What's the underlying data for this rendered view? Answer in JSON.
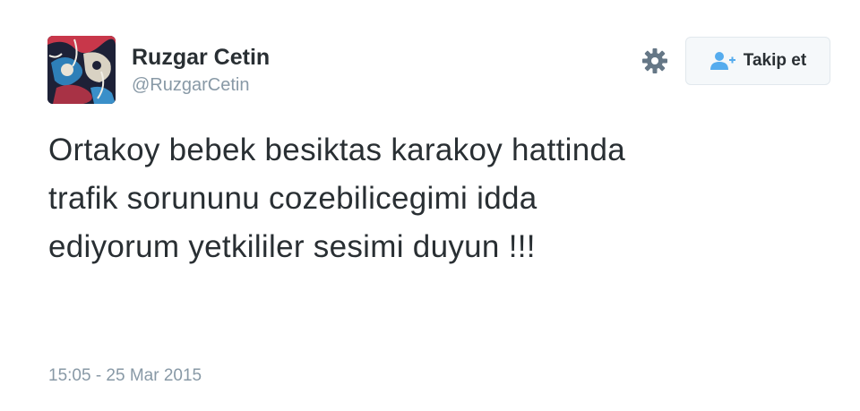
{
  "user": {
    "name": "Ruzgar Cetin",
    "handle": "@RuzgarCetin"
  },
  "actions": {
    "settings_icon": "gear-icon",
    "follow_icon": "add-user-icon",
    "follow_label": "Takip et"
  },
  "tweet": {
    "text_lines": [
      "Ortakoy bebek besiktas karakoy hattinda",
      "trafik sorununu cozebilicegimi idda",
      "ediyorum yetkililer sesimi duyun !!!"
    ],
    "timestamp": "15:05 - 25 Mar 2015"
  },
  "colors": {
    "text": "#292f33",
    "muted": "#8899a6",
    "accent": "#55acee",
    "button_bg": "#f5f8fa",
    "button_border": "#e1e8ed"
  }
}
